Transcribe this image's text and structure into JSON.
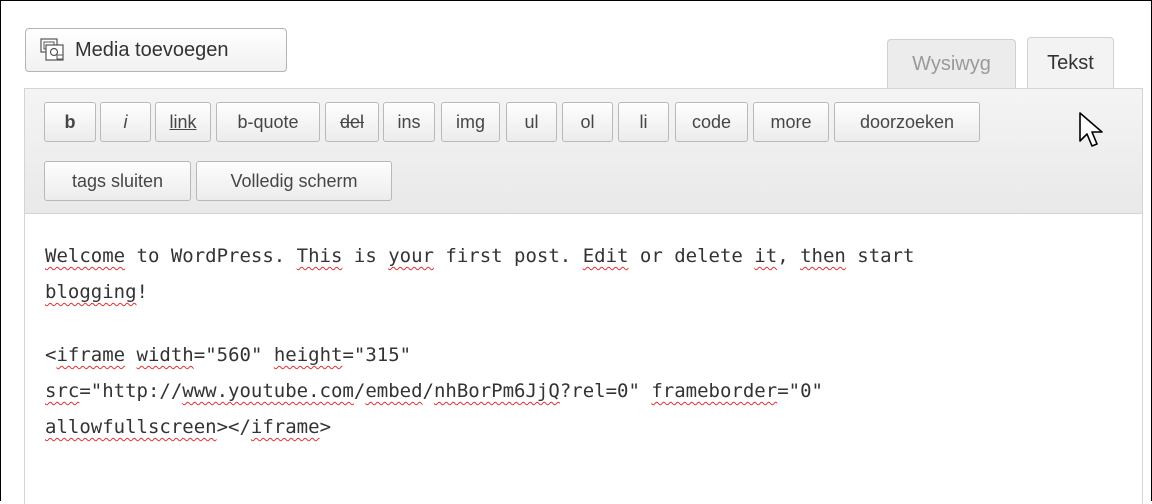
{
  "media": {
    "label": "Media toevoegen",
    "icon": "media-icon"
  },
  "tabs": [
    {
      "label": "Wysiwyg",
      "active": false
    },
    {
      "label": "Tekst",
      "active": true
    }
  ],
  "toolbar": {
    "buttons": [
      "b",
      "i",
      "link",
      "b-quote",
      "del",
      "ins",
      "img",
      "ul",
      "ol",
      "li",
      "code",
      "more",
      "doorzoeken",
      "tags sluiten",
      "Volledig scherm"
    ]
  },
  "content": {
    "line1": [
      {
        "t": "Welcome",
        "s": true
      },
      {
        "t": " to WordPress. ",
        "s": false
      },
      {
        "t": "This",
        "s": true
      },
      {
        "t": " is ",
        "s": false
      },
      {
        "t": "your",
        "s": true
      },
      {
        "t": " first post. ",
        "s": false
      },
      {
        "t": "Edit",
        "s": true
      },
      {
        "t": " or delete ",
        "s": false
      },
      {
        "t": "it",
        "s": true
      },
      {
        "t": ", ",
        "s": false
      },
      {
        "t": "then",
        "s": true
      },
      {
        "t": " start",
        "s": false
      }
    ],
    "line2": [
      {
        "t": "blogging",
        "s": true
      },
      {
        "t": "!",
        "s": false
      }
    ],
    "line3": [
      {
        "t": "<",
        "s": false
      },
      {
        "t": "iframe",
        "s": true
      },
      {
        "t": " ",
        "s": false
      },
      {
        "t": "width",
        "s": true
      },
      {
        "t": "=\"560\" ",
        "s": false
      },
      {
        "t": "height",
        "s": true
      },
      {
        "t": "=\"315\"",
        "s": false
      }
    ],
    "line4": [
      {
        "t": "src",
        "s": true
      },
      {
        "t": "=\"http://",
        "s": false
      },
      {
        "t": "www.youtube.com",
        "s": true
      },
      {
        "t": "/",
        "s": false
      },
      {
        "t": "embed",
        "s": true
      },
      {
        "t": "/",
        "s": false
      },
      {
        "t": "nhBorPm6JjQ",
        "s": true
      },
      {
        "t": "?rel=0\" ",
        "s": false
      },
      {
        "t": "frameborder",
        "s": true
      },
      {
        "t": "=\"0\"",
        "s": false
      }
    ],
    "line5": [
      {
        "t": "allowfullscreen",
        "s": true
      },
      {
        "t": "></",
        "s": false
      },
      {
        "t": "iframe",
        "s": true
      },
      {
        "t": ">",
        "s": false
      }
    ]
  }
}
